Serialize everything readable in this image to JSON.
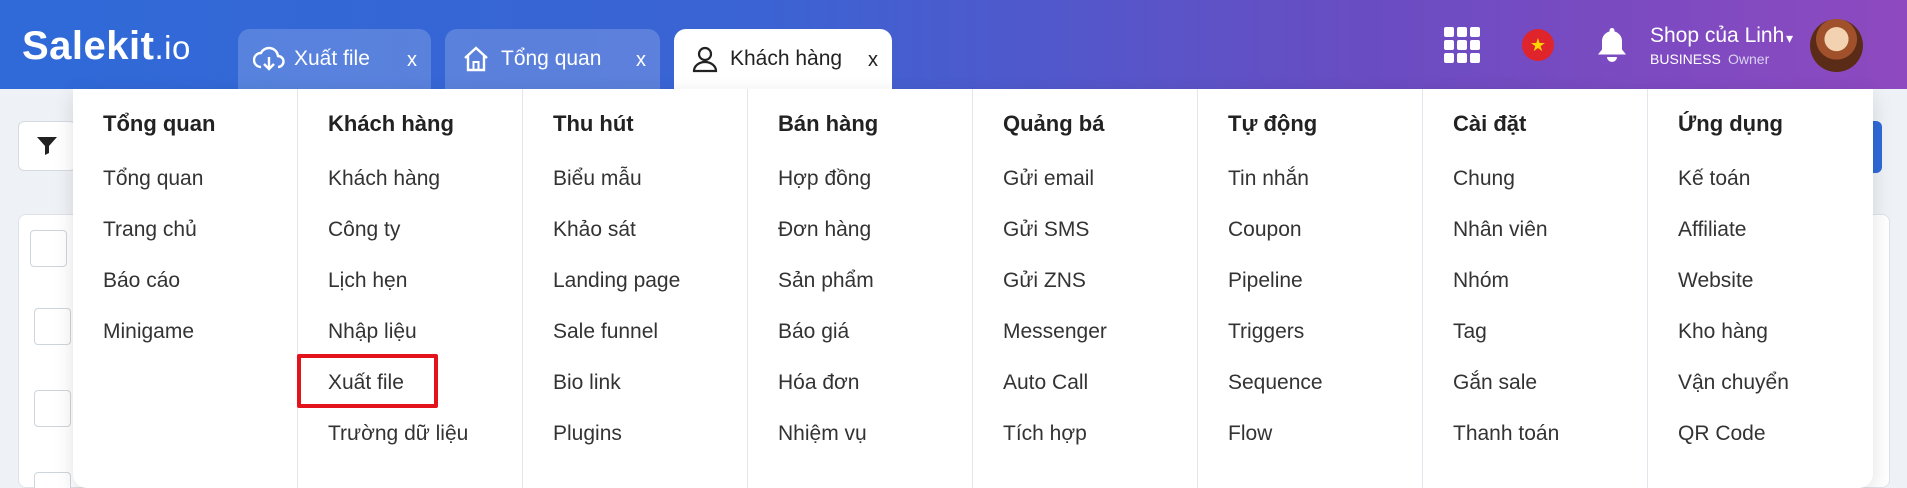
{
  "header": {
    "logo_main": "Salekit",
    "logo_suffix": ".io",
    "tabs": [
      {
        "label": "Xuất file",
        "icon": "cloud-download-icon",
        "close": "x"
      },
      {
        "label": "Tổng quan",
        "icon": "home-icon",
        "close": "x"
      },
      {
        "label": "Khách hàng",
        "icon": "user-icon",
        "close": "x"
      }
    ],
    "active_tab": "Khách hàng",
    "shop_name": "Shop của Linh",
    "caret": "▾",
    "plan": "BUSINESS",
    "role": "Owner",
    "flag_star": "★"
  },
  "menu": {
    "columns": [
      {
        "heading": "Tổng quan",
        "items": [
          "Tổng quan",
          "Trang chủ",
          "Báo cáo",
          "Minigame"
        ]
      },
      {
        "heading": "Khách hàng",
        "items": [
          "Khách hàng",
          "Công ty",
          "Lịch hẹn",
          "Nhập liệu",
          "Xuất file",
          "Trường dữ liệu"
        ]
      },
      {
        "heading": "Thu hút",
        "items": [
          "Biểu mẫu",
          "Khảo sát",
          "Landing page",
          "Sale funnel",
          "Bio link",
          "Plugins"
        ]
      },
      {
        "heading": "Bán hàng",
        "items": [
          "Hợp đồng",
          "Đơn hàng",
          "Sản phẩm",
          "Báo giá",
          "Hóa đơn",
          "Nhiệm vụ"
        ]
      },
      {
        "heading": "Quảng bá",
        "items": [
          "Gửi email",
          "Gửi SMS",
          "Gửi ZNS",
          "Messenger",
          "Auto Call",
          "Tích hợp"
        ]
      },
      {
        "heading": "Tự động",
        "items": [
          "Tin nhắn",
          "Coupon",
          "Pipeline",
          "Triggers",
          "Sequence",
          "Flow"
        ]
      },
      {
        "heading": "Cài đặt",
        "items": [
          "Chung",
          "Nhân viên",
          "Nhóm",
          "Tag",
          "Gắn sale",
          "Thanh toán"
        ]
      },
      {
        "heading": "Ứng dụng",
        "items": [
          "Kế toán",
          "Affiliate",
          "Website",
          "Kho hàng",
          "Vận chuyển",
          "QR Code"
        ]
      }
    ],
    "highlighted_item": "Xuất file"
  },
  "colors": {
    "header_start": "#2f6ad8",
    "header_end": "#8e49c0",
    "highlight": "#e3121b"
  }
}
